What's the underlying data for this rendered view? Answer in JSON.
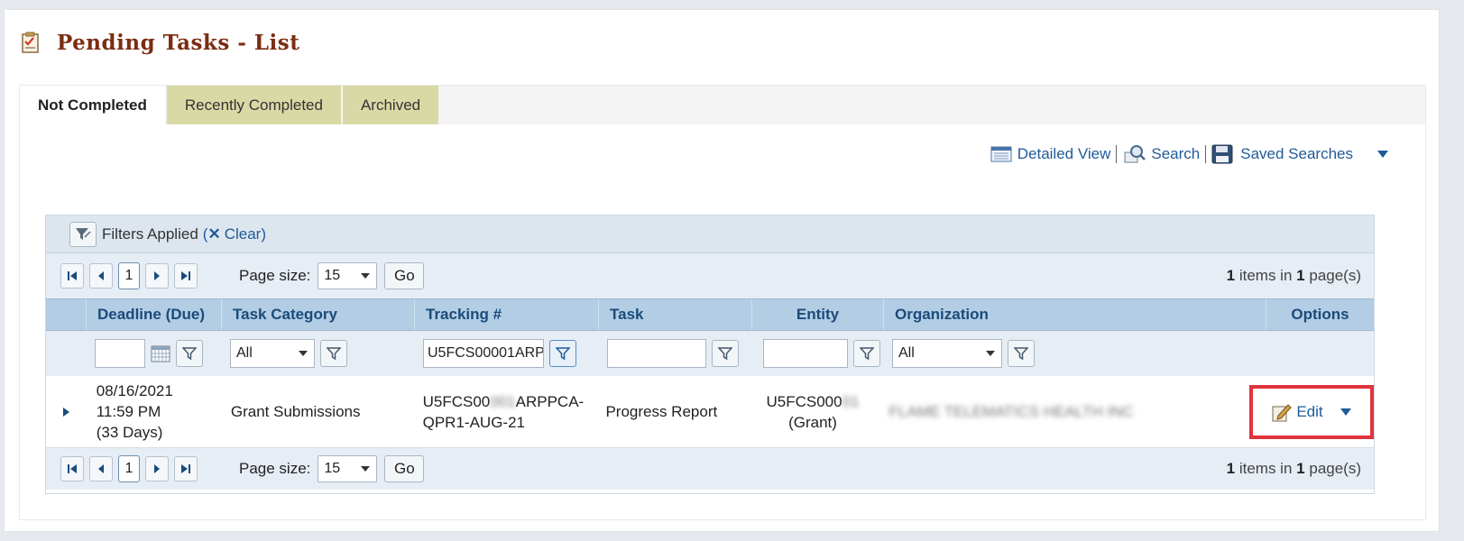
{
  "page": {
    "title": "Pending Tasks - List"
  },
  "tabs": [
    {
      "label": "Not Completed",
      "active": true
    },
    {
      "label": "Recently Completed",
      "active": false
    },
    {
      "label": "Archived",
      "active": false
    }
  ],
  "toolbar": {
    "detailed_view": "Detailed View",
    "search": "Search",
    "saved_searches": "Saved Searches"
  },
  "filters": {
    "applied_text": "Filters Applied",
    "open_paren": "(",
    "clear_label": "Clear",
    "close_paren": ")"
  },
  "pager": {
    "current_page": "1",
    "page_size_label": "Page size:",
    "page_size": "15",
    "go_label": "Go",
    "item_count": "1",
    "items_in_text": "items in",
    "page_count": "1",
    "pages_text": "page(s)"
  },
  "columns": {
    "deadline": "Deadline (Due)",
    "task_category": "Task Category",
    "tracking": "Tracking #",
    "task": "Task",
    "entity": "Entity",
    "organization": "Organization",
    "options": "Options"
  },
  "column_filters": {
    "deadline_value": "",
    "task_category_value": "All",
    "tracking_value": "U5FCS00001ARP",
    "task_value": "",
    "entity_value": "",
    "organization_value": "All"
  },
  "rows": [
    {
      "deadline_date": "08/16/2021",
      "deadline_time": "11:59 PM",
      "deadline_days": "(33 Days)",
      "task_category": "Grant Submissions",
      "tracking_a": "U5FCS00",
      "tracking_blur": "001",
      "tracking_b": "ARPPCA-",
      "tracking_line2": "QPR1-AUG-21",
      "task": "Progress Report",
      "entity_a": "U5FCS000",
      "entity_blur": "01",
      "entity_line2": "(Grant)",
      "organization": "FLAME TELEMATICS HEALTH INC",
      "edit_label": "Edit"
    }
  ],
  "colors": {
    "title": "#7b2d12",
    "link": "#1f5a99",
    "header_bg": "#b3cde4",
    "tab_inactive": "#d9d9a6",
    "highlight": "#e2343c"
  }
}
